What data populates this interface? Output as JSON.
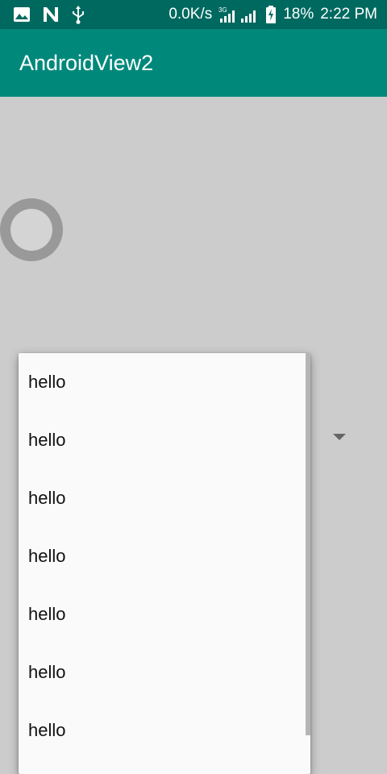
{
  "status_bar": {
    "left_icons": [
      "image-icon",
      "n-icon",
      "usb-icon"
    ],
    "net_speed": "0.0K/s",
    "network_type": "3G",
    "battery": "18%",
    "time": "2:22 PM"
  },
  "app_bar": {
    "title": "AndroidView2"
  },
  "dropdown": {
    "items": [
      "hello",
      "hello",
      "hello",
      "hello",
      "hello",
      "hello",
      "hello"
    ]
  },
  "colors": {
    "status_bar": "#00695f",
    "app_bar": "#00897b",
    "background": "#cccccc"
  }
}
